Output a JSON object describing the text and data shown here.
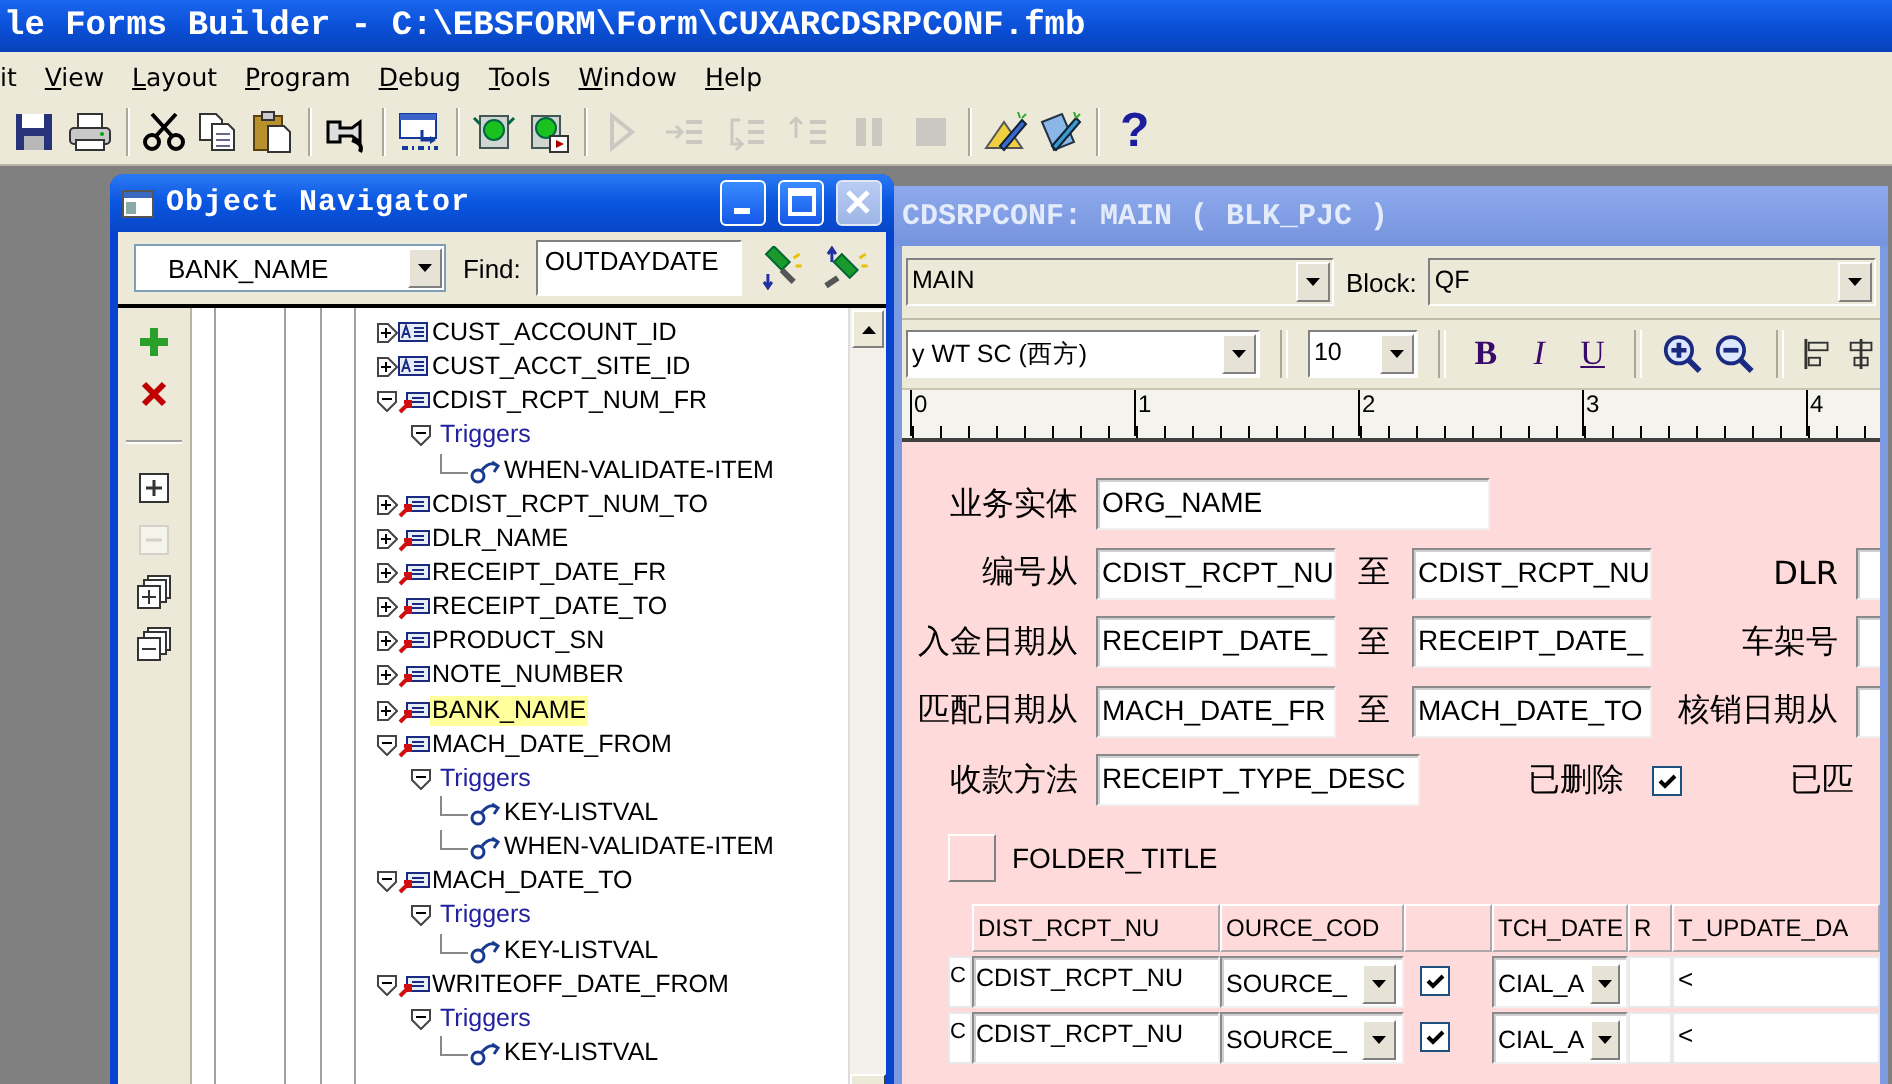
{
  "window": {
    "title": "le Forms Builder - C:\\EBSFORM\\Form\\CUXARCDSRPCONF.fmb"
  },
  "menu": [
    {
      "label": "it",
      "mnemonic": false
    },
    {
      "label": "View",
      "mnemonic": true
    },
    {
      "label": "Layout",
      "mnemonic": true
    },
    {
      "label": "Program",
      "mnemonic": true
    },
    {
      "label": "Debug",
      "mnemonic": true
    },
    {
      "label": "Tools",
      "mnemonic": true
    },
    {
      "label": "Window",
      "mnemonic": true
    },
    {
      "label": "Help",
      "mnemonic": true
    }
  ],
  "toolbar": [
    [
      {
        "kind": "save",
        "disabled": false
      },
      {
        "kind": "print",
        "disabled": false
      }
    ],
    [
      {
        "kind": "cut",
        "disabled": false
      },
      {
        "kind": "copy",
        "disabled": false
      },
      {
        "kind": "paste",
        "disabled": false
      }
    ],
    [
      {
        "kind": "connect",
        "disabled": false
      }
    ],
    [
      {
        "kind": "compile",
        "disabled": false
      }
    ],
    [
      {
        "kind": "run_form",
        "disabled": false
      },
      {
        "kind": "debug_form",
        "disabled": false
      }
    ],
    [
      {
        "kind": "run",
        "disabled": true
      },
      {
        "kind": "step_into",
        "disabled": true
      },
      {
        "kind": "step_over",
        "disabled": true
      },
      {
        "kind": "step_out",
        "disabled": true
      },
      {
        "kind": "pause",
        "disabled": true
      },
      {
        "kind": "stop",
        "disabled": true
      }
    ],
    [
      {
        "kind": "layout_editor",
        "disabled": false
      },
      {
        "kind": "plsql_editor",
        "disabled": false
      }
    ],
    [
      {
        "kind": "help",
        "label": "?",
        "disabled": false
      }
    ]
  ],
  "navigator": {
    "title": "Object Navigator",
    "window_buttons": [
      {
        "kind": "minimize",
        "disabled": false
      },
      {
        "kind": "maximize",
        "disabled": false
      },
      {
        "kind": "close",
        "disabled": true
      }
    ],
    "object_selector": "BANK_NAME",
    "find_label": "Find:",
    "find_value": "OUTDAYDATE",
    "side_tools": [
      {
        "kind": "create",
        "disabled": false
      },
      {
        "kind": "delete",
        "disabled": false
      },
      {
        "kind": "expand",
        "disabled": false
      },
      {
        "kind": "collapse",
        "disabled": true
      },
      {
        "kind": "expand_all",
        "disabled": false
      },
      {
        "kind": "collapse_all",
        "disabled": false
      }
    ],
    "tree": [
      {
        "label": "CUST_ACCOUNT_ID",
        "kind": "text",
        "expanded": false,
        "highlighted": false
      },
      {
        "label": "CUST_ACCT_SITE_ID",
        "kind": "text",
        "expanded": false,
        "highlighted": false
      },
      {
        "label": "CDIST_RCPT_NUM_FR",
        "kind": "lov",
        "expanded": true,
        "highlighted": false,
        "children": [
          {
            "label": "Triggers",
            "kind": "group",
            "expanded": true,
            "children": [
              {
                "label": "WHEN-VALIDATE-ITEM",
                "kind": "trigger"
              }
            ]
          }
        ]
      },
      {
        "label": "CDIST_RCPT_NUM_TO",
        "kind": "lov",
        "expanded": false,
        "highlighted": false
      },
      {
        "label": "DLR_NAME",
        "kind": "lov",
        "expanded": false,
        "highlighted": false
      },
      {
        "label": "RECEIPT_DATE_FR",
        "kind": "lov",
        "expanded": false,
        "highlighted": false
      },
      {
        "label": "RECEIPT_DATE_TO",
        "kind": "lov",
        "expanded": false,
        "highlighted": false
      },
      {
        "label": "PRODUCT_SN",
        "kind": "lov",
        "expanded": false,
        "highlighted": false
      },
      {
        "label": "NOTE_NUMBER",
        "kind": "lov",
        "expanded": false,
        "highlighted": false
      },
      {
        "label": "BANK_NAME",
        "kind": "lov",
        "expanded": false,
        "highlighted": true
      },
      {
        "label": "MACH_DATE_FROM",
        "kind": "lov",
        "expanded": true,
        "highlighted": false,
        "children": [
          {
            "label": "Triggers",
            "kind": "group",
            "expanded": true,
            "children": [
              {
                "label": "KEY-LISTVAL",
                "kind": "trigger"
              },
              {
                "label": "WHEN-VALIDATE-ITEM",
                "kind": "trigger"
              }
            ]
          }
        ]
      },
      {
        "label": "MACH_DATE_TO",
        "kind": "lov",
        "expanded": true,
        "highlighted": false,
        "children": [
          {
            "label": "Triggers",
            "kind": "group",
            "expanded": true,
            "children": [
              {
                "label": "KEY-LISTVAL",
                "kind": "trigger"
              }
            ]
          }
        ]
      },
      {
        "label": "WRITEOFF_DATE_FROM",
        "kind": "lov",
        "expanded": true,
        "highlighted": false,
        "children": [
          {
            "label": "Triggers",
            "kind": "group",
            "expanded": true,
            "children": [
              {
                "label": "KEY-LISTVAL",
                "kind": "trigger"
              }
            ]
          }
        ]
      }
    ]
  },
  "layout_editor": {
    "title": "CDSRPCONF: MAIN ( BLK_PJC )",
    "canvas_selector": "MAIN",
    "block_label": "Block:",
    "block_selector": "QF",
    "font_selector": "y WT SC (西方)",
    "size_selector": "10",
    "format_buttons": [
      "B",
      "I",
      "U"
    ],
    "ruler_labels": [
      "0",
      "1",
      "2",
      "3",
      "4"
    ],
    "form": {
      "rows": [
        {
          "kind": "single",
          "label": "业务实体",
          "value": "ORG_NAME"
        },
        {
          "kind": "range",
          "label": "编号从",
          "from": "CDIST_RCPT_NU",
          "separator": "至",
          "to": "CDIST_RCPT_NU",
          "right_label": "DLR"
        },
        {
          "kind": "range",
          "label": "入金日期从",
          "from": "RECEIPT_DATE_",
          "separator": "至",
          "to": "RECEIPT_DATE_",
          "right_label": "车架号"
        },
        {
          "kind": "range",
          "label": "匹配日期从",
          "from": "MACH_DATE_FR",
          "separator": "至",
          "to": "MACH_DATE_TO",
          "right_label": "核销日期从"
        },
        {
          "kind": "check",
          "label": "收款方法",
          "value": "RECEIPT_TYPE_DESC",
          "check_label": "已删除",
          "checked": true,
          "right_label": "已匹"
        }
      ],
      "folder_title": "FOLDER_TITLE",
      "table": {
        "columns": [
          {
            "kind": "text",
            "label": "DIST_RCPT_NU"
          },
          {
            "kind": "text",
            "label": "OURCE_COD"
          },
          {
            "kind": "blank"
          },
          {
            "kind": "text",
            "label": "TCH_DATE"
          },
          {
            "kind": "text",
            "label": "R"
          },
          {
            "kind": "text",
            "label": "T_UPDATE_DA"
          }
        ],
        "rows": [
          {
            "column_0": "C",
            "column_1": "CDIST_RCPT_NU",
            "column_2": "SOURCE_",
            "checked": true,
            "column_4": "CIAL_A",
            "column_6": "<"
          },
          {
            "column_0": "C",
            "column_1": "CDIST_RCPT_NU",
            "column_2": "SOURCE_",
            "checked": true,
            "column_4": "CIAL_A",
            "column_6": "<"
          }
        ]
      }
    }
  }
}
